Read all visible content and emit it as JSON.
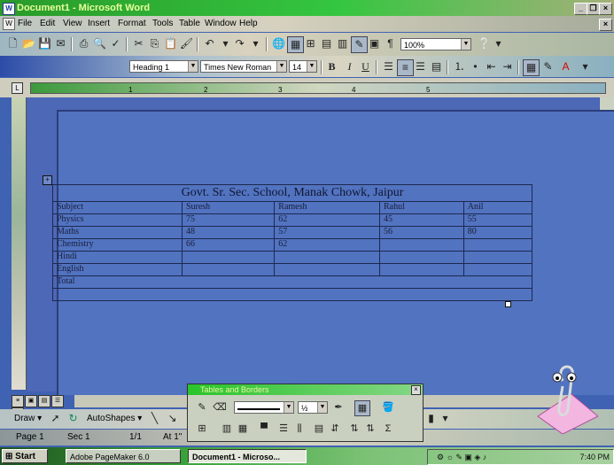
{
  "window": {
    "title": "Document1 - Microsoft Word",
    "buttons": {
      "minimize": "_",
      "maximize": "❐",
      "close": "×"
    }
  },
  "menu": [
    "File",
    "Edit",
    "View",
    "Insert",
    "Format",
    "Tools",
    "Table",
    "Window",
    "Help"
  ],
  "formatting": {
    "style": "Heading 1",
    "font": "Times New Roman",
    "size": "14",
    "zoom": "100%"
  },
  "ruler": {
    "corner": "L",
    "ticks": [
      "1",
      "2",
      "3",
      "4",
      "5"
    ]
  },
  "document": {
    "table_caption": "Govt. Sr. Sec. School, Manak Chowk, Jaipur",
    "header": [
      "Subject",
      "Suresh",
      "Ramesh",
      "Rahul",
      "Anil"
    ],
    "rows": [
      [
        "Physics",
        "75",
        "62",
        "45",
        "55"
      ],
      [
        "Maths",
        "48",
        "57",
        "56",
        "80"
      ],
      [
        "Chemistry",
        "66",
        "62",
        "",
        ""
      ],
      [
        "Hindi",
        "",
        "",
        "",
        ""
      ],
      [
        "English",
        "",
        "",
        "",
        ""
      ],
      [
        "Total",
        "",
        "",
        "",
        ""
      ]
    ]
  },
  "drawing_toolbar": {
    "draw": "Draw",
    "autoshapes": "AutoShapes"
  },
  "tables_borders": {
    "title": "Tables and Borders",
    "line_weight": "½"
  },
  "status": {
    "page": "Page 1",
    "sec": "Sec 1",
    "pos": "1/1",
    "at": "At 1\""
  },
  "taskbar": {
    "start": "Start",
    "tasks": [
      "Adobe PageMaker 6.0",
      "Document1 - Microso..."
    ],
    "clock": "7:40 PM"
  },
  "colors": {
    "title_green": "#34c640",
    "doc_blue": "#4c68b6"
  }
}
